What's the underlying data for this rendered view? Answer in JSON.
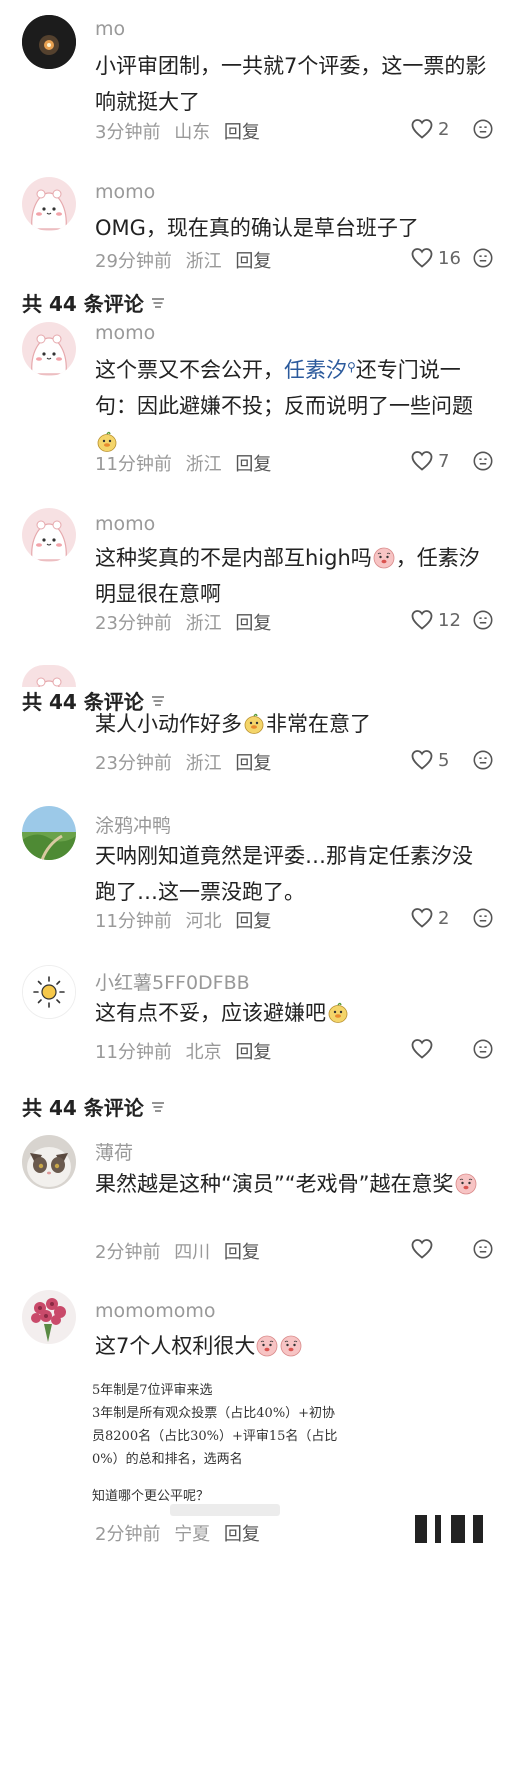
{
  "comments": [
    {
      "name": "mo",
      "text": "小评审团制，一共就7个评委，这一票的影响就挺大了",
      "time": "3分钟前",
      "location": "山东",
      "likes": "2"
    },
    {
      "name": "momo",
      "text": "OMG，现在真的确认是草台班子了",
      "time": "29分钟前",
      "location": "浙江",
      "likes": "16"
    },
    {
      "name": "momo",
      "text_a": "这个票又不会公开，",
      "mention": "任素汐",
      "text_b": "还专门说一句：因此避嫌不投；反而说明了一些问题",
      "time": "11分钟前",
      "location": "浙江",
      "likes": "7"
    },
    {
      "name": "momo",
      "text_a": "这种奖真的不是内部互high吗",
      "text_b": "，任素汐明显很在意啊",
      "time": "23分钟前",
      "location": "浙江",
      "likes": "12"
    },
    {
      "text_a": "某人小动作好多",
      "text_b": "非常在意了",
      "time": "23分钟前",
      "location": "浙江",
      "likes": "5"
    },
    {
      "name": "涂鸦冲鸭",
      "text": "天呐刚知道竟然是评委…那肯定任素汐没跑了…这一票没跑了。",
      "time": "11分钟前",
      "location": "河北",
      "likes": "2"
    },
    {
      "name": "小红薯5FF0DFBB",
      "text": "这有点不妥，应该避嫌吧",
      "time": "11分钟前",
      "location": "北京"
    },
    {
      "name": "薄荷",
      "text": "果然越是这种“演员”“老戏骨”越在意奖",
      "time": "2分钟前",
      "location": "四川"
    },
    {
      "name": "momomomo",
      "text": "这7个人权利很大",
      "time": "2分钟前",
      "location": "宁夏"
    }
  ],
  "header": {
    "label": "共 44 条评论"
  },
  "reply_label": "回复",
  "handwritten": {
    "line1": "5年制是7位评审来选",
    "line2": "3年制是所有观众投票（占比40%）+初协",
    "line3": "员8200名（占比30%）+评审15名（占比",
    "line4": "0%）的总和排名，选两名",
    "line5": "知道哪个更公平呢？"
  },
  "colors": {
    "mention": "#2b5a9c",
    "muted": "#999999"
  }
}
